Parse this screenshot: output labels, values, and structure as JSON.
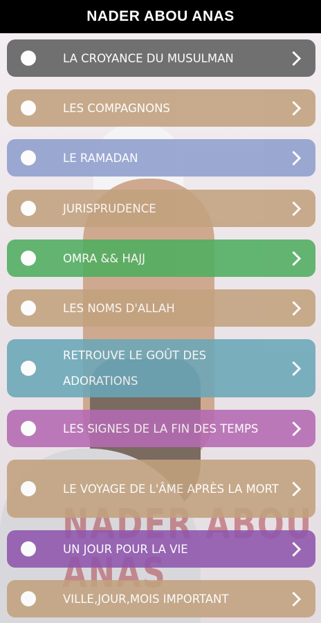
{
  "app": {
    "title": "NADER ABOU ANAS"
  },
  "background": {
    "watermark_text": "NADER ABOU ANAS"
  },
  "colors": {
    "gray": "#5f5f60",
    "tan": "#c2a27e",
    "blue": "#8f9fce",
    "green": "#4fae60",
    "teal": "#6aa7b8",
    "purple": "#b56ab3",
    "violet": "#8f56ad"
  },
  "menu": {
    "items": [
      {
        "label": "LA CROYANCE DU MUSULMAN",
        "color": "#5f5f60",
        "icon": "chevron-right-icon"
      },
      {
        "label": "LES COMPAGNONS",
        "color": "#c2a27e",
        "icon": "chevron-right-icon"
      },
      {
        "label": "LE RAMADAN",
        "color": "#8f9fce",
        "icon": "chevron-right-icon"
      },
      {
        "label": "JURISPRUDENCE",
        "color": "#c2a27e",
        "icon": "chevron-right-icon"
      },
      {
        "label": "OMRA && HAJJ",
        "color": "#4fae60",
        "icon": "chevron-right-icon"
      },
      {
        "label": "LES NOMS D'ALLAH",
        "color": "#c2a27e",
        "icon": "chevron-right-icon"
      },
      {
        "label": "RETROUVE LE GOÛT DES ADORATIONS",
        "color": "#6aa7b8",
        "icon": "chevron-right-icon"
      },
      {
        "label": "LES SIGNES DE LA FIN DES TEMPS",
        "color": "#b56ab3",
        "icon": "chevron-right-icon"
      },
      {
        "label": "LE VOYAGE DE L'ÂME APRÈS LA MORT",
        "color": "#c2a27e",
        "icon": "chevron-right-icon"
      },
      {
        "label": "UN JOUR POUR LA VIE",
        "color": "#8f56ad",
        "icon": "chevron-right-icon"
      },
      {
        "label": "VILLE,JOUR,MOIS IMPORTANT",
        "color": "#c2a27e",
        "icon": "chevron-right-icon"
      }
    ]
  }
}
